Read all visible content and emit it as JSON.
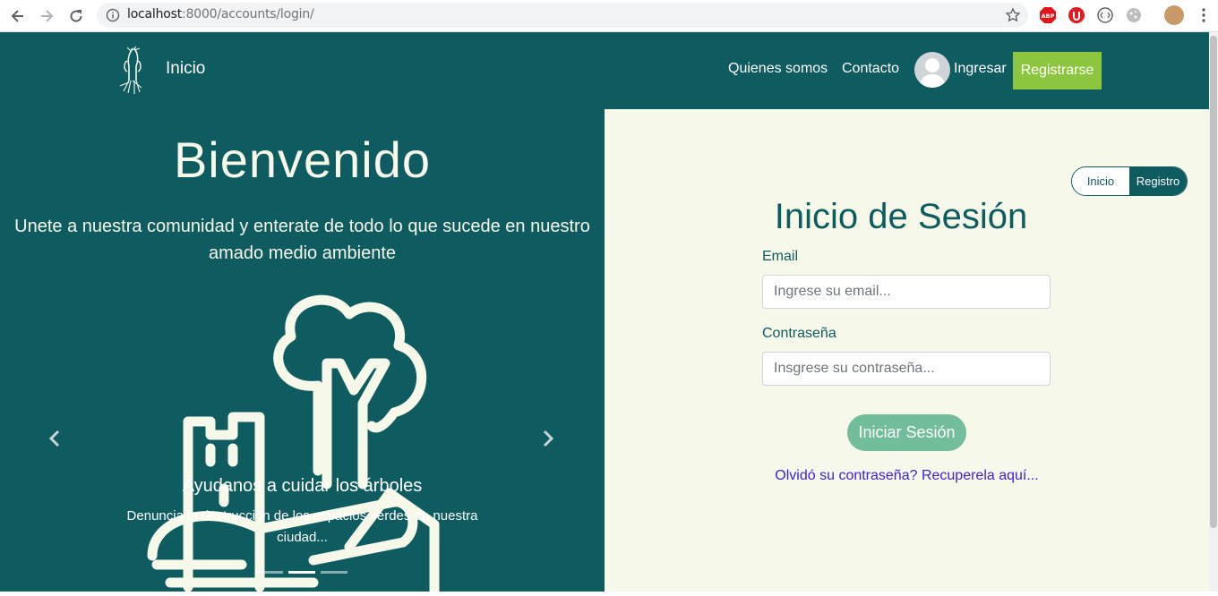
{
  "browser": {
    "url_host": "localhost",
    "url_rest": ":8000/accounts/login/"
  },
  "navbar": {
    "brand": "Inicio",
    "links": [
      "Quienes somos",
      "Contacto"
    ],
    "login": "Ingresar",
    "register": "Registrarse"
  },
  "hero": {
    "title": "Bienvenido",
    "subtitle": "Unete a nuestra comunidad y enterate de todo lo que sucede en nuestro amado medio ambiente"
  },
  "carousel": {
    "caption_title": "Ayudanos a cuidar los árboles",
    "caption_text": "Denuncia la destrucción de los espacios verdes de nuestra ciudad...",
    "slide_count": 3,
    "active_index": 1
  },
  "login": {
    "toggle_login": "Inicio",
    "toggle_register": "Registro",
    "title": "Inicio de Sesión",
    "email_label": "Email",
    "email_placeholder": "Ingrese su email...",
    "password_label": "Contraseña",
    "password_placeholder": "Insgrese su contraseña...",
    "submit": "Iniciar Sesión",
    "recover": "Olvidó su contraseña? Recuperela aquí..."
  },
  "colors": {
    "primary": "#0e5b60",
    "panel_bg": "#f6f9ea",
    "register_btn": "#8cc63e",
    "login_btn": "#72bd9a",
    "link": "#3d1fd8"
  }
}
